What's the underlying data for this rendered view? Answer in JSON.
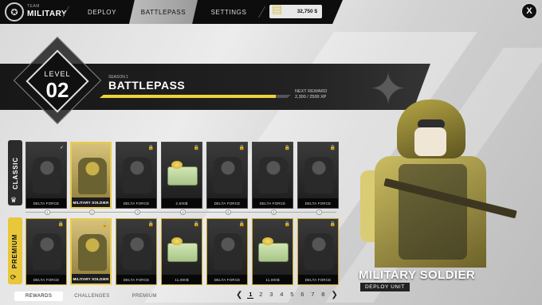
{
  "app": {
    "brand_small": "TEAM",
    "brand": "MILITARY"
  },
  "nav": {
    "tabs": [
      {
        "label": "DEPLOY"
      },
      {
        "label": "BATTLEPASS"
      },
      {
        "label": "SETTINGS"
      }
    ],
    "active_tab": "BATTLEPASS"
  },
  "currency": {
    "amount": "32,750 $",
    "icon": "money-stack-icon"
  },
  "close_label": "X",
  "header": {
    "level_label": "LEVEL",
    "level_value": "02",
    "season": "SEASON 1",
    "title": "BATTLEPASS",
    "next_reward_label": "NEXT REWARD",
    "xp_text": "2,300 / 2500 XP",
    "xp_progress": 0.92
  },
  "rows": {
    "classic_label": "CLASSIC",
    "premium_label": "PREMIUM",
    "classic": [
      {
        "label": "DELTA FORCE",
        "type": "soldier",
        "badge": "✓",
        "highlight": false
      },
      {
        "label": "MILITARY SOLDIER",
        "type": "soldier",
        "badge": "",
        "highlight": true
      },
      {
        "label": "DELTA FORCE",
        "type": "soldier",
        "badge": "🔒",
        "highlight": false
      },
      {
        "label": "2,500$",
        "type": "cash",
        "badge": "🔒",
        "highlight": false
      },
      {
        "label": "DELTA FORCE",
        "type": "soldier",
        "badge": "🔒",
        "highlight": false
      },
      {
        "label": "DELTA FORCE",
        "type": "soldier",
        "badge": "🔒",
        "highlight": false
      },
      {
        "label": "DELTA FORCE",
        "type": "soldier",
        "badge": "🔒",
        "highlight": false
      }
    ],
    "premium": [
      {
        "label": "DELTA FORCE",
        "type": "soldier",
        "badge": "🔒",
        "highlight": false
      },
      {
        "label": "MILITARY SOLDIER",
        "type": "soldier",
        "badge": "🔒",
        "highlight": true
      },
      {
        "label": "DELTA FORCE",
        "type": "soldier",
        "badge": "🔒",
        "highlight": false
      },
      {
        "label": "11,000$",
        "type": "cash",
        "badge": "🔒",
        "highlight": false
      },
      {
        "label": "DELTA FORCE",
        "type": "soldier",
        "badge": "🔒",
        "highlight": false
      },
      {
        "label": "11,000$",
        "type": "cash",
        "badge": "🔒",
        "highlight": false
      },
      {
        "label": "DELTA FORCE",
        "type": "soldier",
        "badge": "🔒",
        "highlight": false
      }
    ],
    "levels": [
      "1",
      "2",
      "3",
      "4",
      "5",
      "6",
      "7"
    ]
  },
  "featured": {
    "name": "MILITARY SOLDIER",
    "action": "DEPLOY UNIT"
  },
  "bottom_tabs": [
    {
      "label": "REWARDS",
      "active": true
    },
    {
      "label": "CHALLENGES",
      "active": false
    },
    {
      "label": "PREMIUM",
      "active": false
    }
  ],
  "pager": {
    "pages": [
      "1",
      "2",
      "3",
      "4",
      "5",
      "6",
      "7",
      "8"
    ],
    "active": "1"
  }
}
